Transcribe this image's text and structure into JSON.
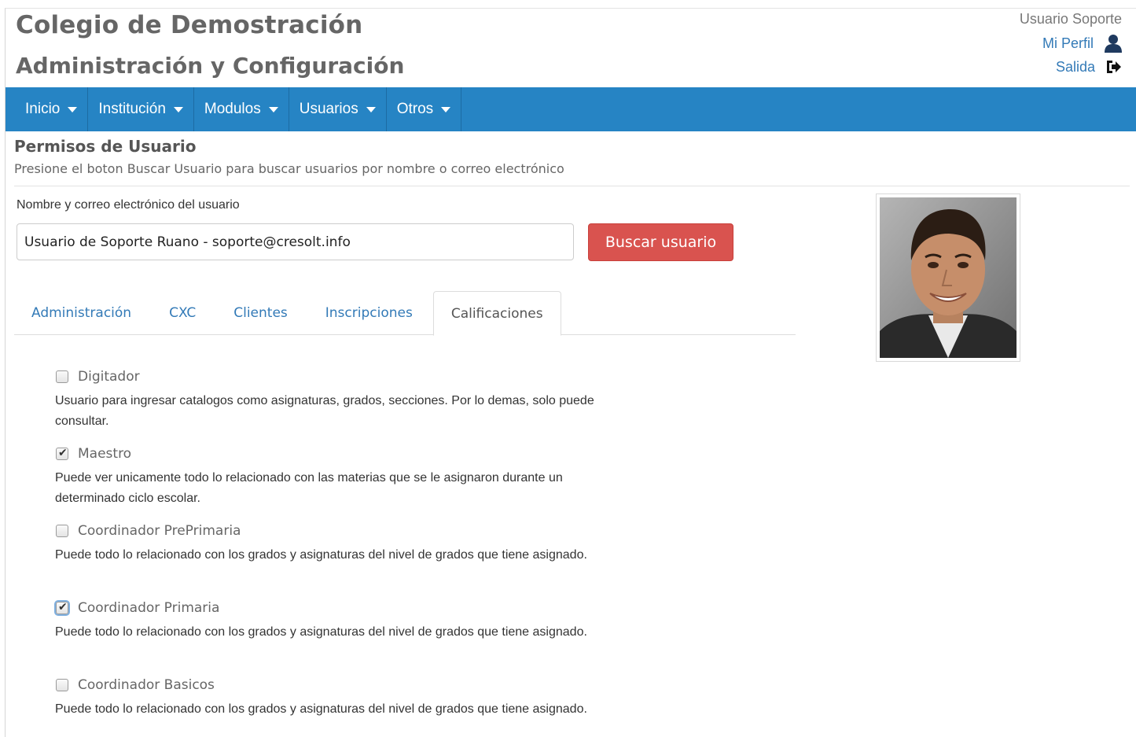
{
  "header": {
    "school_name": "Colegio de Demostración",
    "section_name": "Administración y Configuración"
  },
  "user_menu": {
    "user_name": "Usuario Soporte",
    "profile_label": "Mi Perfil",
    "logout_label": "Salida"
  },
  "nav": {
    "items": [
      {
        "label": "Inicio"
      },
      {
        "label": "Institución"
      },
      {
        "label": "Modulos"
      },
      {
        "label": "Usuarios"
      },
      {
        "label": "Otros"
      }
    ]
  },
  "page": {
    "title": "Permisos de Usuario",
    "subtitle": "Presione el boton Buscar Usuario para buscar usuarios por nombre o correo electrónico"
  },
  "search": {
    "label": "Nombre y correo electrónico del usuario",
    "value": "Usuario de Soporte Ruano - soporte@cresolt.info",
    "button_label": "Buscar usuario"
  },
  "tabs": [
    {
      "label": "Administración",
      "active": false
    },
    {
      "label": "CXC",
      "active": false
    },
    {
      "label": "Clientes",
      "active": false
    },
    {
      "label": "Inscripciones",
      "active": false
    },
    {
      "label": "Calificaciones",
      "active": true
    }
  ],
  "permissions": [
    {
      "name": "Digitador",
      "checked": false,
      "description": "Usuario para ingresar catalogos como asignaturas, grados, secciones. Por lo demas, solo puede consultar."
    },
    {
      "name": "Maestro",
      "checked": true,
      "description": "Puede ver unicamente todo lo relacionado con las materias que se le asignaron durante un determinado ciclo escolar."
    },
    {
      "name": "Coordinador PrePrimaria",
      "checked": false,
      "description": "Puede todo lo relacionado con los grados y asignaturas del nivel de grados que tiene asignado."
    },
    {
      "name": "Coordinador Primaria",
      "checked": true,
      "description": "Puede todo lo relacionado con los grados y asignaturas del nivel de grados que tiene asignado."
    },
    {
      "name": "Coordinador Basicos",
      "checked": false,
      "description": "Puede todo lo relacionado con los grados y asignaturas del nivel de grados que tiene asignado."
    }
  ],
  "colors": {
    "navbar": "#2684c4",
    "danger_button": "#d9534f",
    "link": "#337ab7"
  },
  "icons": {
    "profile": "user-icon",
    "logout": "logout-icon"
  }
}
